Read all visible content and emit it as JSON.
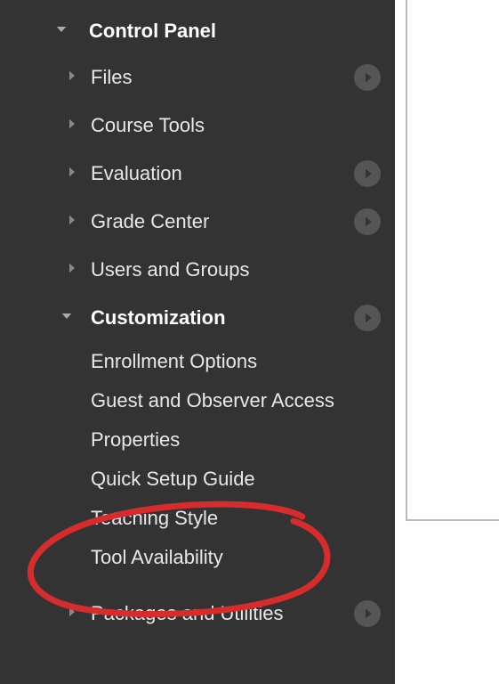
{
  "panel": {
    "title": "Control Panel",
    "items": [
      {
        "label": "Files",
        "expanded": false,
        "hasArrow": true
      },
      {
        "label": "Course Tools",
        "expanded": false,
        "hasArrow": false
      },
      {
        "label": "Evaluation",
        "expanded": false,
        "hasArrow": true
      },
      {
        "label": "Grade Center",
        "expanded": false,
        "hasArrow": true
      },
      {
        "label": "Users and Groups",
        "expanded": false,
        "hasArrow": false
      },
      {
        "label": "Customization",
        "expanded": true,
        "hasArrow": true,
        "children": [
          {
            "label": "Enrollment Options"
          },
          {
            "label": "Guest and Observer Access"
          },
          {
            "label": "Properties"
          },
          {
            "label": "Quick Setup Guide"
          },
          {
            "label": "Teaching Style"
          },
          {
            "label": "Tool Availability"
          }
        ]
      },
      {
        "label": "Packages and Utilities",
        "expanded": false,
        "hasArrow": true
      }
    ]
  },
  "annotation": {
    "highlighted_item": "Tool Availability",
    "color": "#d62c2c"
  }
}
